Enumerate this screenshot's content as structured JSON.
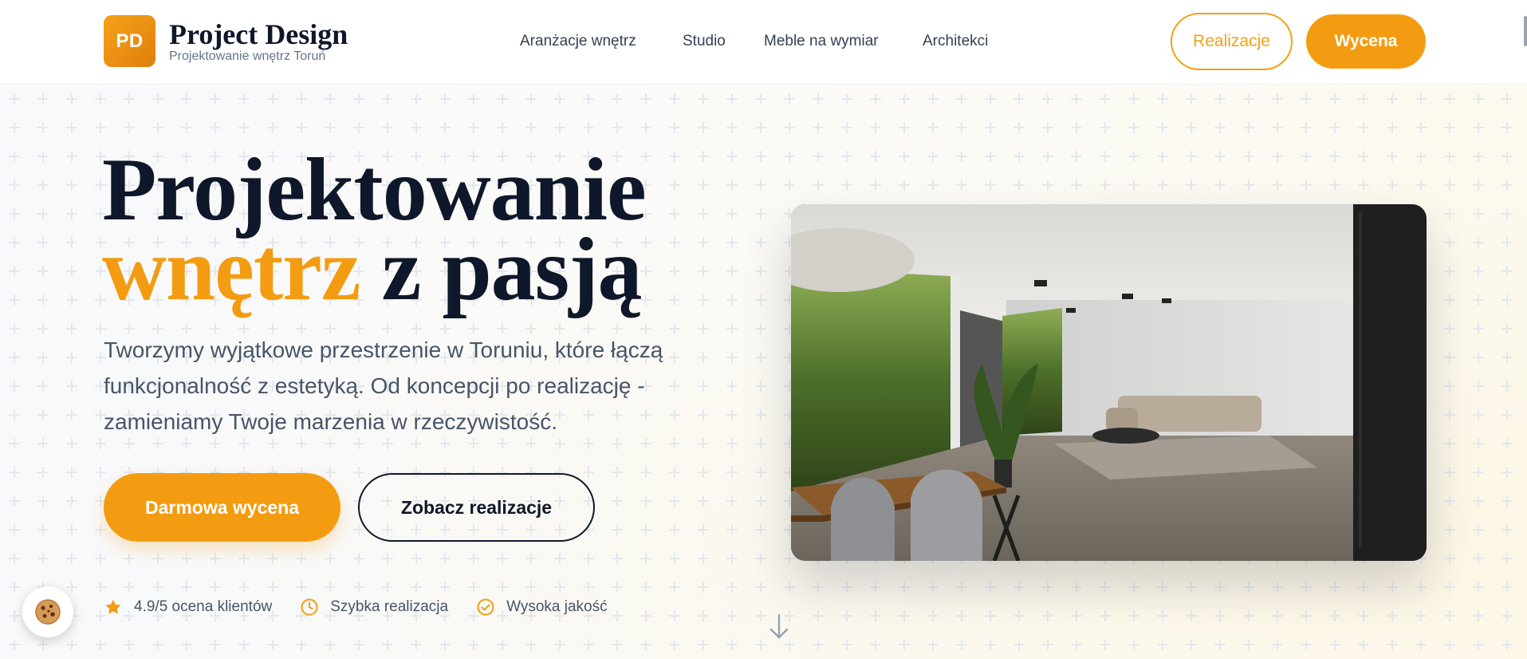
{
  "header": {
    "logo_badge": "PD",
    "brand_name": "Project Design",
    "brand_sub": "Projektowanie wnętrz Toruń",
    "nav": [
      "Aranżacje wnętrz",
      "Studio",
      "Meble na wymiar",
      "Architekci"
    ],
    "btn_realizacje": "Realizacje",
    "btn_wycena": "Wycena"
  },
  "hero": {
    "title_line1": "Projektowanie",
    "title_accent": "wnętrz",
    "title_rest": " z pasją",
    "lead": "Tworzymy wyjątkowe przestrzenie w Toruniu, które łączą funkcjonalność z estetyką. Od koncepcji po realizację - zamieniamy Twoje marzenia w rzeczywistość.",
    "btn_primary": "Darmowa wycena",
    "btn_secondary": "Zobacz realizacje",
    "features": [
      {
        "icon": "star-icon",
        "label": "4.9/5 ocena klientów"
      },
      {
        "icon": "clock-icon",
        "label": "Szybka realizacja"
      },
      {
        "icon": "check-circle-icon",
        "label": "Wysoka jakość"
      }
    ],
    "image_alt": "Wizualizacja salonu z jadalnią"
  },
  "colors": {
    "accent": "#f39c12",
    "text_dark": "#0f172a",
    "text_muted": "#475569"
  }
}
